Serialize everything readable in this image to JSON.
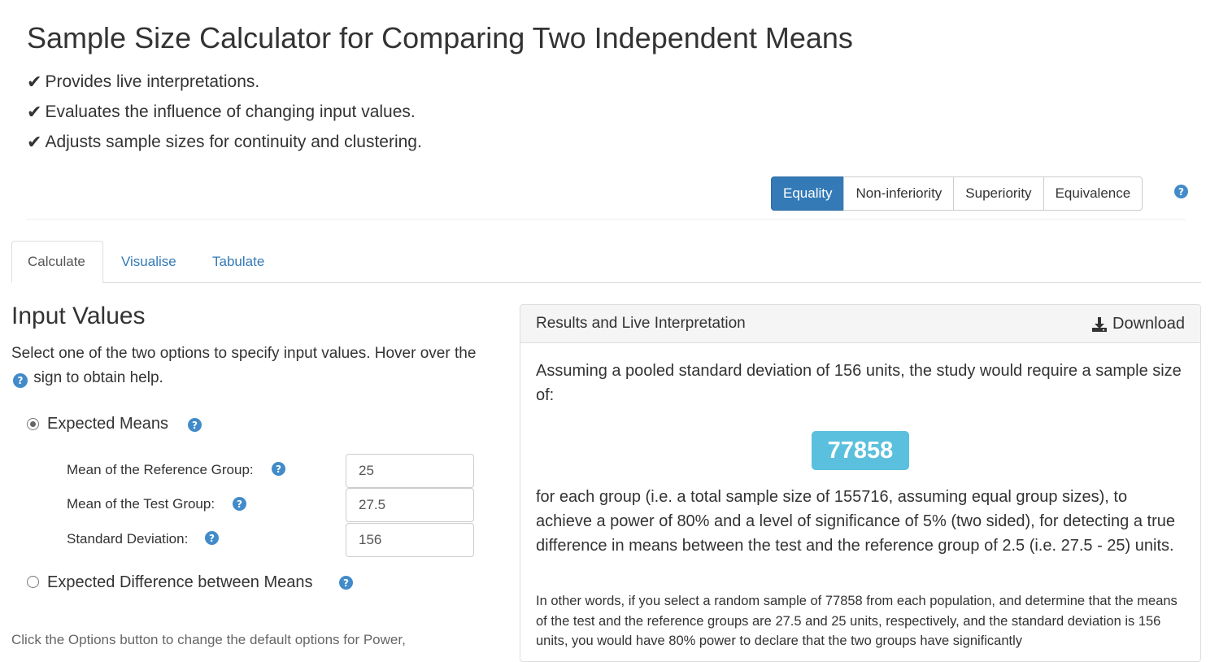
{
  "header": {
    "title": "Sample Size Calculator for Comparing Two Independent Means",
    "features": [
      "Provides live interpretations.",
      "Evaluates the influence of changing input values.",
      "Adjusts sample sizes for continuity and clustering."
    ],
    "check_icon": "check-icon"
  },
  "mode_tabs": [
    {
      "label": "Equality",
      "active": true
    },
    {
      "label": "Non-inferiority",
      "active": false
    },
    {
      "label": "Superiority",
      "active": false
    },
    {
      "label": "Equivalence",
      "active": false
    }
  ],
  "main_tabs": [
    {
      "label": "Calculate",
      "active": true
    },
    {
      "label": "Visualise",
      "active": false
    },
    {
      "label": "Tabulate",
      "active": false
    }
  ],
  "input": {
    "heading": "Input Values",
    "intro_before": "Select one of the two options to specify input values. Hover over the",
    "intro_after": "sign to obtain help.",
    "option_means": {
      "label": "Expected Means",
      "selected": true
    },
    "option_difference": {
      "label": "Expected Difference between Means",
      "selected": false
    },
    "fields": {
      "reference_mean": {
        "label": "Mean of the Reference Group:",
        "value": "25"
      },
      "test_mean": {
        "label": "Mean of the Test Group:",
        "value": "27.5"
      },
      "std_dev": {
        "label": "Standard Deviation:",
        "value": "156"
      }
    },
    "options_note": "Click the Options button to change the default options for Power,"
  },
  "results": {
    "title": "Results and Live Interpretation",
    "download_label": "Download",
    "assumption": "Assuming a pooled standard deviation of 156 units, the study would require a sample size of:",
    "sample_size": "77858",
    "statement": "for each group (i.e. a total sample size of 155716, assuming equal group sizes), to achieve a power of 80% and a level of significance of 5% (two sided), for detecting a true difference in means between the test and the reference group of 2.5 (i.e. 27.5 - 25) units.",
    "elaboration": "In other words, if you select a random sample of 77858 from each population, and determine that the means of the test and the reference groups are 27.5 and 25 units, respectively, and the standard deviation is 156 units, you would have 80% power to declare that the two groups have significantly"
  },
  "colors": {
    "primary": "#337ab7",
    "help_icon": "#428bca",
    "badge": "#5bc0de",
    "link": "#337ab7"
  }
}
